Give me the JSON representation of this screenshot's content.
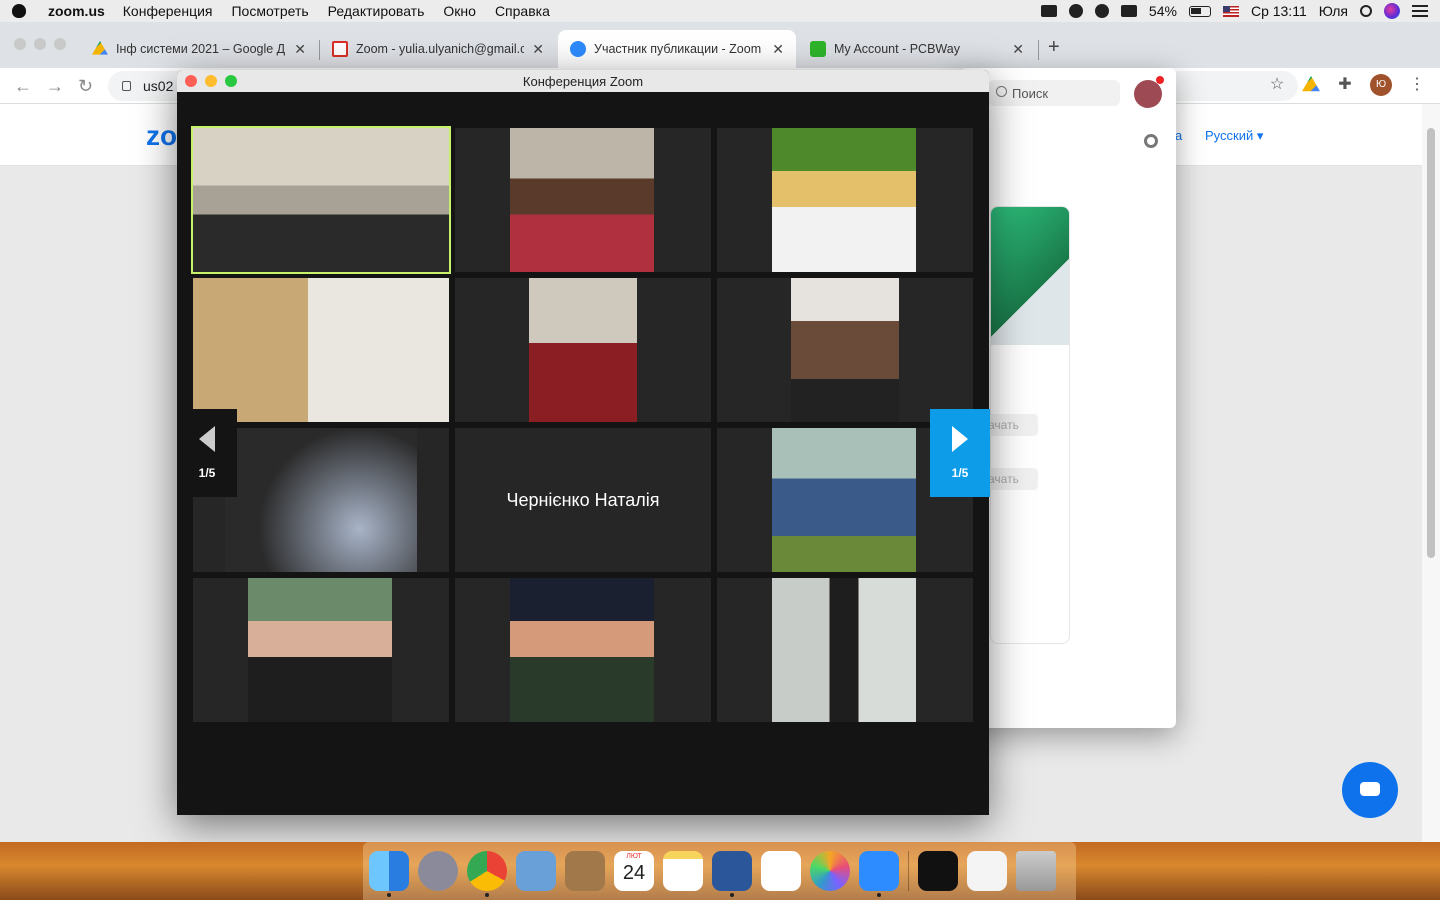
{
  "menubar": {
    "app_name": "zoom.us",
    "items": [
      "Конференция",
      "Посмотреть",
      "Редактировать",
      "Окно",
      "Справка"
    ],
    "battery_percent": "54%",
    "clock": "Ср 13:11",
    "user": "Юля"
  },
  "browser": {
    "tabs": [
      {
        "title": "Інф системи 2021 – Google Ди",
        "favicon": "google-drive-icon",
        "active": false
      },
      {
        "title": "Zoom - yulia.ulyanich@gmail.c",
        "favicon": "gmail-icon",
        "active": false
      },
      {
        "title": "Участник публикации - Zoom",
        "favicon": "zoom-icon",
        "active": true
      },
      {
        "title": "My Account - PCBWay",
        "favicon": "pcbway-icon",
        "active": false
      }
    ],
    "url": "us02",
    "profile_initial": "Ю"
  },
  "zoom_site": {
    "logo": "zo",
    "lang_prefix": "а",
    "language": "Русский",
    "search_placeholder": "Поиск",
    "button_1": "ачать",
    "button_2": "ачать"
  },
  "meeting": {
    "window_title": "Конференция Zoom",
    "page_left": "1/5",
    "page_right": "1/5",
    "name_only_participant": "Чернієнко Наталія"
  },
  "dock": {
    "calendar_month": "ЛЮТ",
    "calendar_day": "24"
  },
  "colors": {
    "zoom_blue": "#0e72ed",
    "active_speaker": "#c9f26b",
    "pager_active": "#0d9de8"
  }
}
